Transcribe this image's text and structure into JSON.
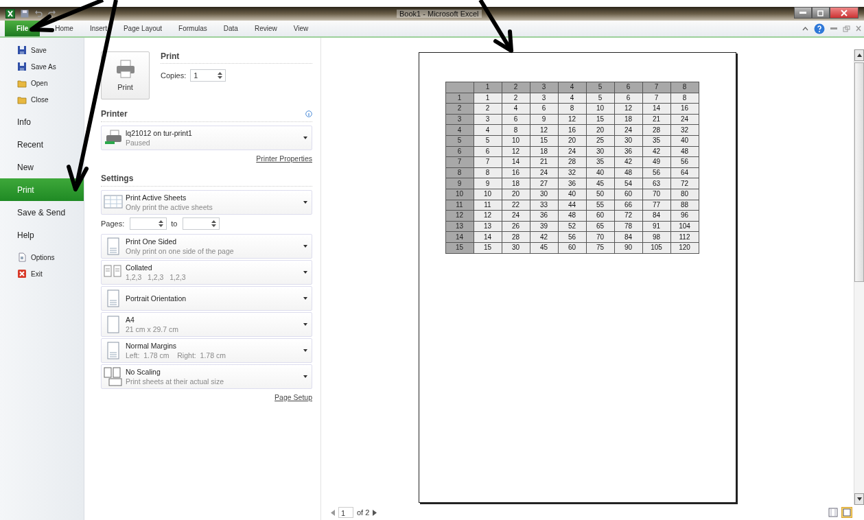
{
  "window": {
    "title": "Book1  -  Microsoft Excel"
  },
  "ribbon_tabs": [
    {
      "label": "File",
      "selected": true
    },
    {
      "label": "Home",
      "selected": false
    },
    {
      "label": "Insert",
      "selected": false
    },
    {
      "label": "Page Layout",
      "selected": false
    },
    {
      "label": "Formulas",
      "selected": false
    },
    {
      "label": "Data",
      "selected": false
    },
    {
      "label": "Review",
      "selected": false
    },
    {
      "label": "View",
      "selected": false
    }
  ],
  "backstage_menu": [
    {
      "label": "Save",
      "kind": "command",
      "selected": false
    },
    {
      "label": "Save As",
      "kind": "command",
      "selected": false
    },
    {
      "label": "Open",
      "kind": "command",
      "selected": false
    },
    {
      "label": "Close",
      "kind": "command",
      "selected": false
    },
    {
      "label": "Info",
      "kind": "tab",
      "selected": false
    },
    {
      "label": "Recent",
      "kind": "tab",
      "selected": false
    },
    {
      "label": "New",
      "kind": "tab",
      "selected": false
    },
    {
      "label": "Print",
      "kind": "tab",
      "selected": true
    },
    {
      "label": "Save & Send",
      "kind": "tab",
      "selected": false
    },
    {
      "label": "Help",
      "kind": "tab",
      "selected": false
    },
    {
      "label": "Options",
      "kind": "command",
      "selected": false
    },
    {
      "label": "Exit",
      "kind": "command",
      "selected": false
    }
  ],
  "print_section": {
    "heading": "Print",
    "button": "Print",
    "copies_label": "Copies:",
    "copies": "1"
  },
  "printer": {
    "heading": "Printer",
    "name": "lq21012 on tur-print1",
    "status": "Paused",
    "properties_link": "Printer Properties"
  },
  "settings": {
    "heading": "Settings",
    "pages_label": "Pages:",
    "to_label": "to",
    "page_setup_link": "Page Setup",
    "options": [
      {
        "title": "Print Active Sheets",
        "subtitle": "Only print the active sheets"
      },
      {
        "title": "Print One Sided",
        "subtitle": "Only print on one side of the page"
      },
      {
        "title": "Collated",
        "subtitle": "1,2,3   1,2,3   1,2,3"
      },
      {
        "title": "Portrait Orientation"
      },
      {
        "title": "A4",
        "subtitle": "21 cm x 29.7 cm"
      },
      {
        "title": "Normal Margins",
        "subtitle": "Left:  1.78 cm    Right:  1.78 cm"
      },
      {
        "title": "No Scaling",
        "subtitle": "Print sheets at their actual size"
      }
    ]
  },
  "preview": {
    "table": {
      "columns": [
        "1",
        "2",
        "3",
        "4",
        "5",
        "6",
        "7",
        "8"
      ],
      "rows": [
        {
          "label": "1",
          "values": [
            "1",
            "2",
            "3",
            "4",
            "5",
            "6",
            "7",
            "8"
          ]
        },
        {
          "label": "2",
          "values": [
            "2",
            "4",
            "6",
            "8",
            "10",
            "12",
            "14",
            "16"
          ]
        },
        {
          "label": "3",
          "values": [
            "3",
            "6",
            "9",
            "12",
            "15",
            "18",
            "21",
            "24"
          ]
        },
        {
          "label": "4",
          "values": [
            "4",
            "8",
            "12",
            "16",
            "20",
            "24",
            "28",
            "32"
          ]
        },
        {
          "label": "5",
          "values": [
            "5",
            "10",
            "15",
            "20",
            "25",
            "30",
            "35",
            "40"
          ]
        },
        {
          "label": "6",
          "values": [
            "6",
            "12",
            "18",
            "24",
            "30",
            "36",
            "42",
            "48"
          ]
        },
        {
          "label": "7",
          "values": [
            "7",
            "14",
            "21",
            "28",
            "35",
            "42",
            "49",
            "56"
          ]
        },
        {
          "label": "8",
          "values": [
            "8",
            "16",
            "24",
            "32",
            "40",
            "48",
            "56",
            "64"
          ]
        },
        {
          "label": "9",
          "values": [
            "9",
            "18",
            "27",
            "36",
            "45",
            "54",
            "63",
            "72"
          ]
        },
        {
          "label": "10",
          "values": [
            "10",
            "20",
            "30",
            "40",
            "50",
            "60",
            "70",
            "80"
          ]
        },
        {
          "label": "11",
          "values": [
            "11",
            "22",
            "33",
            "44",
            "55",
            "66",
            "77",
            "88"
          ]
        },
        {
          "label": "12",
          "values": [
            "12",
            "24",
            "36",
            "48",
            "60",
            "72",
            "84",
            "96"
          ]
        },
        {
          "label": "13",
          "values": [
            "13",
            "26",
            "39",
            "52",
            "65",
            "78",
            "91",
            "104"
          ]
        },
        {
          "label": "14",
          "values": [
            "14",
            "28",
            "42",
            "56",
            "70",
            "84",
            "98",
            "112"
          ]
        },
        {
          "label": "15",
          "values": [
            "15",
            "30",
            "45",
            "60",
            "75",
            "90",
            "105",
            "120"
          ]
        }
      ]
    }
  },
  "page_nav": {
    "page": "1",
    "of": "of 2"
  }
}
